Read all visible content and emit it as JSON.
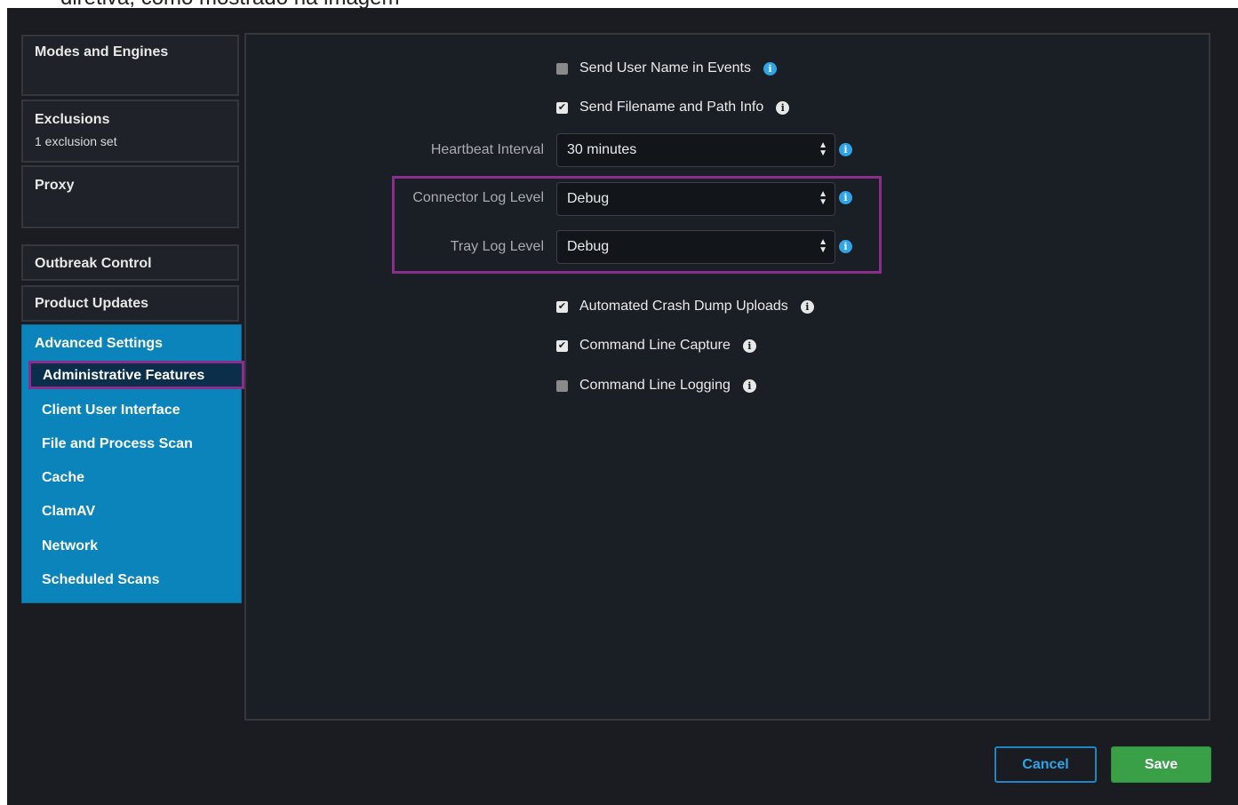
{
  "caption": "diretiva, como mostrado na imagem",
  "sidebar": {
    "groups": [
      {
        "title": "Modes and Engines",
        "sub": ""
      },
      {
        "title": "Exclusions",
        "sub": "1 exclusion set"
      },
      {
        "title": "Proxy",
        "sub": ""
      },
      {
        "title": "Outbreak Control",
        "sub": ""
      },
      {
        "title": "Product Updates",
        "sub": ""
      }
    ],
    "advanced": {
      "title": "Advanced Settings",
      "items": [
        "Administrative Features",
        "Client User Interface",
        "File and Process Scan",
        "Cache",
        "ClamAV",
        "Network",
        "Scheduled Scans"
      ],
      "selected_index": 0
    }
  },
  "main": {
    "send_user_name": {
      "label": "Send User Name in Events",
      "checked": false
    },
    "send_filename": {
      "label": "Send Filename and Path Info",
      "checked": true
    },
    "heartbeat": {
      "label": "Heartbeat Interval",
      "value": "30 minutes"
    },
    "connector_log": {
      "label": "Connector Log Level",
      "value": "Debug"
    },
    "tray_log": {
      "label": "Tray Log Level",
      "value": "Debug"
    },
    "crash_dump": {
      "label": "Automated Crash Dump Uploads",
      "checked": true
    },
    "cmd_capture": {
      "label": "Command Line Capture",
      "checked": true
    },
    "cmd_logging": {
      "label": "Command Line Logging",
      "checked": false
    }
  },
  "buttons": {
    "cancel": "Cancel",
    "save": "Save"
  },
  "colors": {
    "accent": "#0a84ba",
    "highlight": "#8a2d8c",
    "save": "#3aa048"
  }
}
